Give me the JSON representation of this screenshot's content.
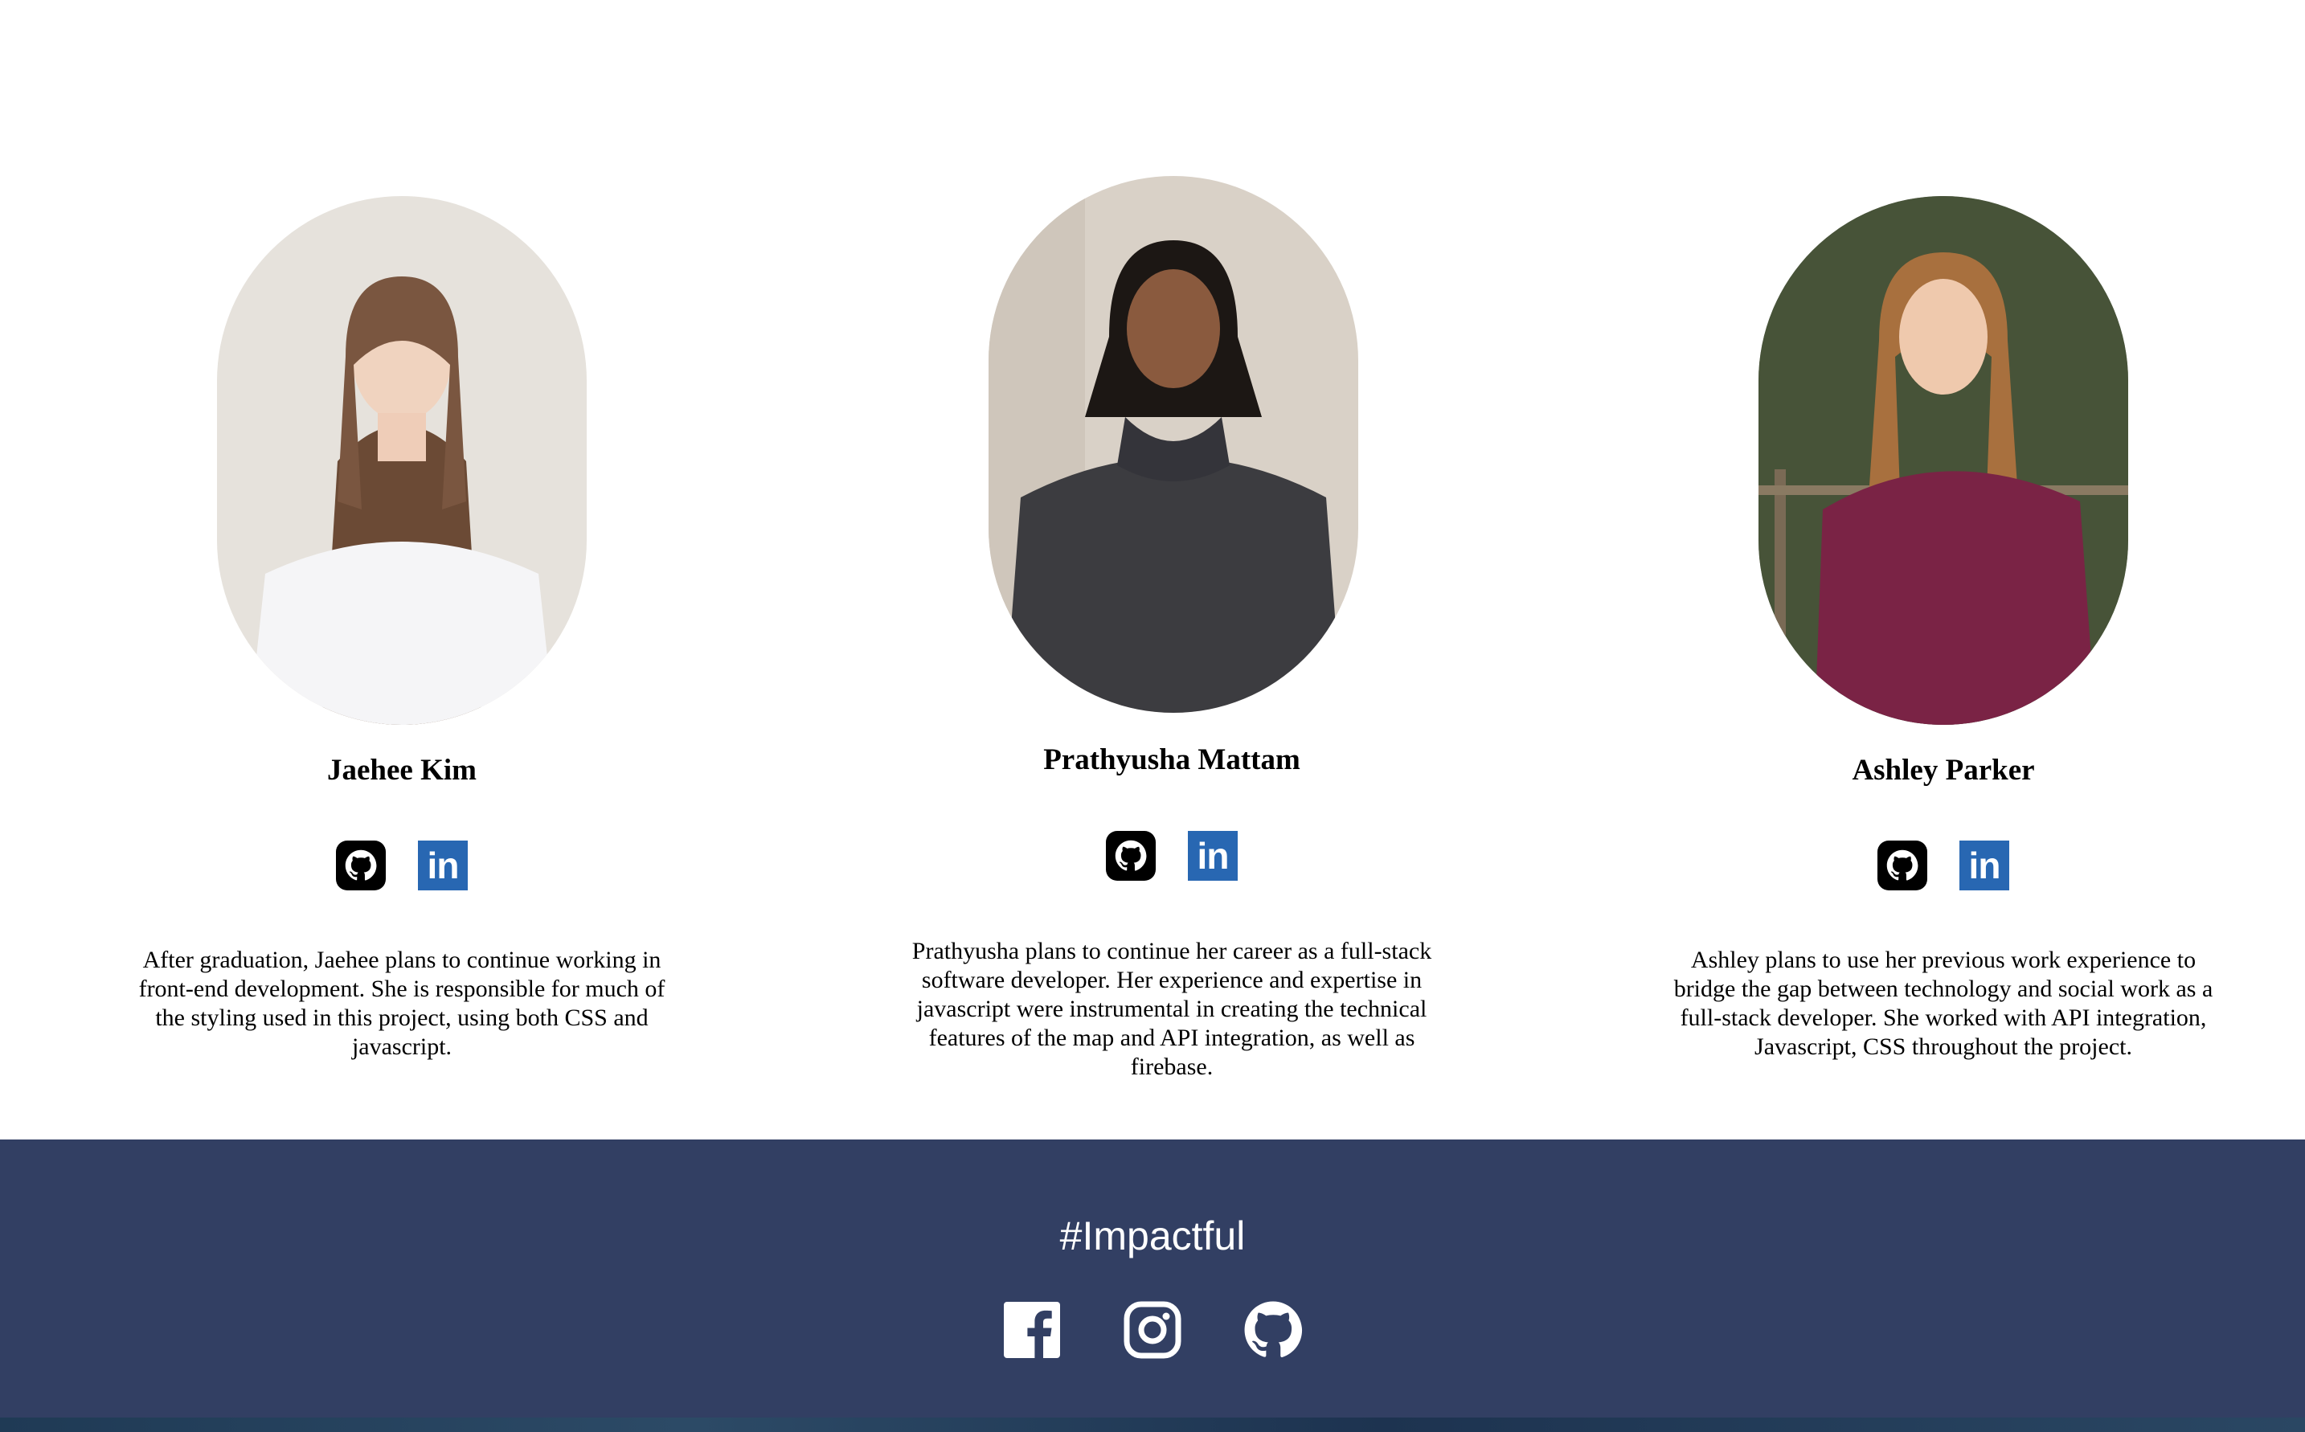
{
  "team": {
    "members": [
      {
        "name": "Jaehee Kim",
        "bio_lines": [
          "After graduation, Jaehee plans to continue working in",
          "front-end development. She is responsible for much of",
          "the styling used in this project, using both CSS and",
          "javascript."
        ]
      },
      {
        "name": "Prathyusha Mattam",
        "bio_lines": [
          "Prathyusha plans to continue her career as a full-stack",
          "software developer. Her experience and expertise in",
          "javascript were instrumental in creating the technical",
          "features of the map and API integration, as well as",
          "firebase."
        ]
      },
      {
        "name": "Ashley Parker",
        "bio_lines": [
          "Ashley plans to use her previous work experience to",
          "bridge the gap between technology and social work as a",
          "full-stack developer. She worked with API integration,",
          "Javascript, CSS throughout the project."
        ]
      }
    ],
    "linkedin_glyph": "in"
  },
  "footer": {
    "tagline": "#Impactful"
  },
  "colors": {
    "footer_bg": "#323f63",
    "linkedin_blue": "#2867b2",
    "github_black": "#000000"
  },
  "icons": [
    "github-icon",
    "linkedin-icon",
    "facebook-icon",
    "instagram-icon"
  ]
}
